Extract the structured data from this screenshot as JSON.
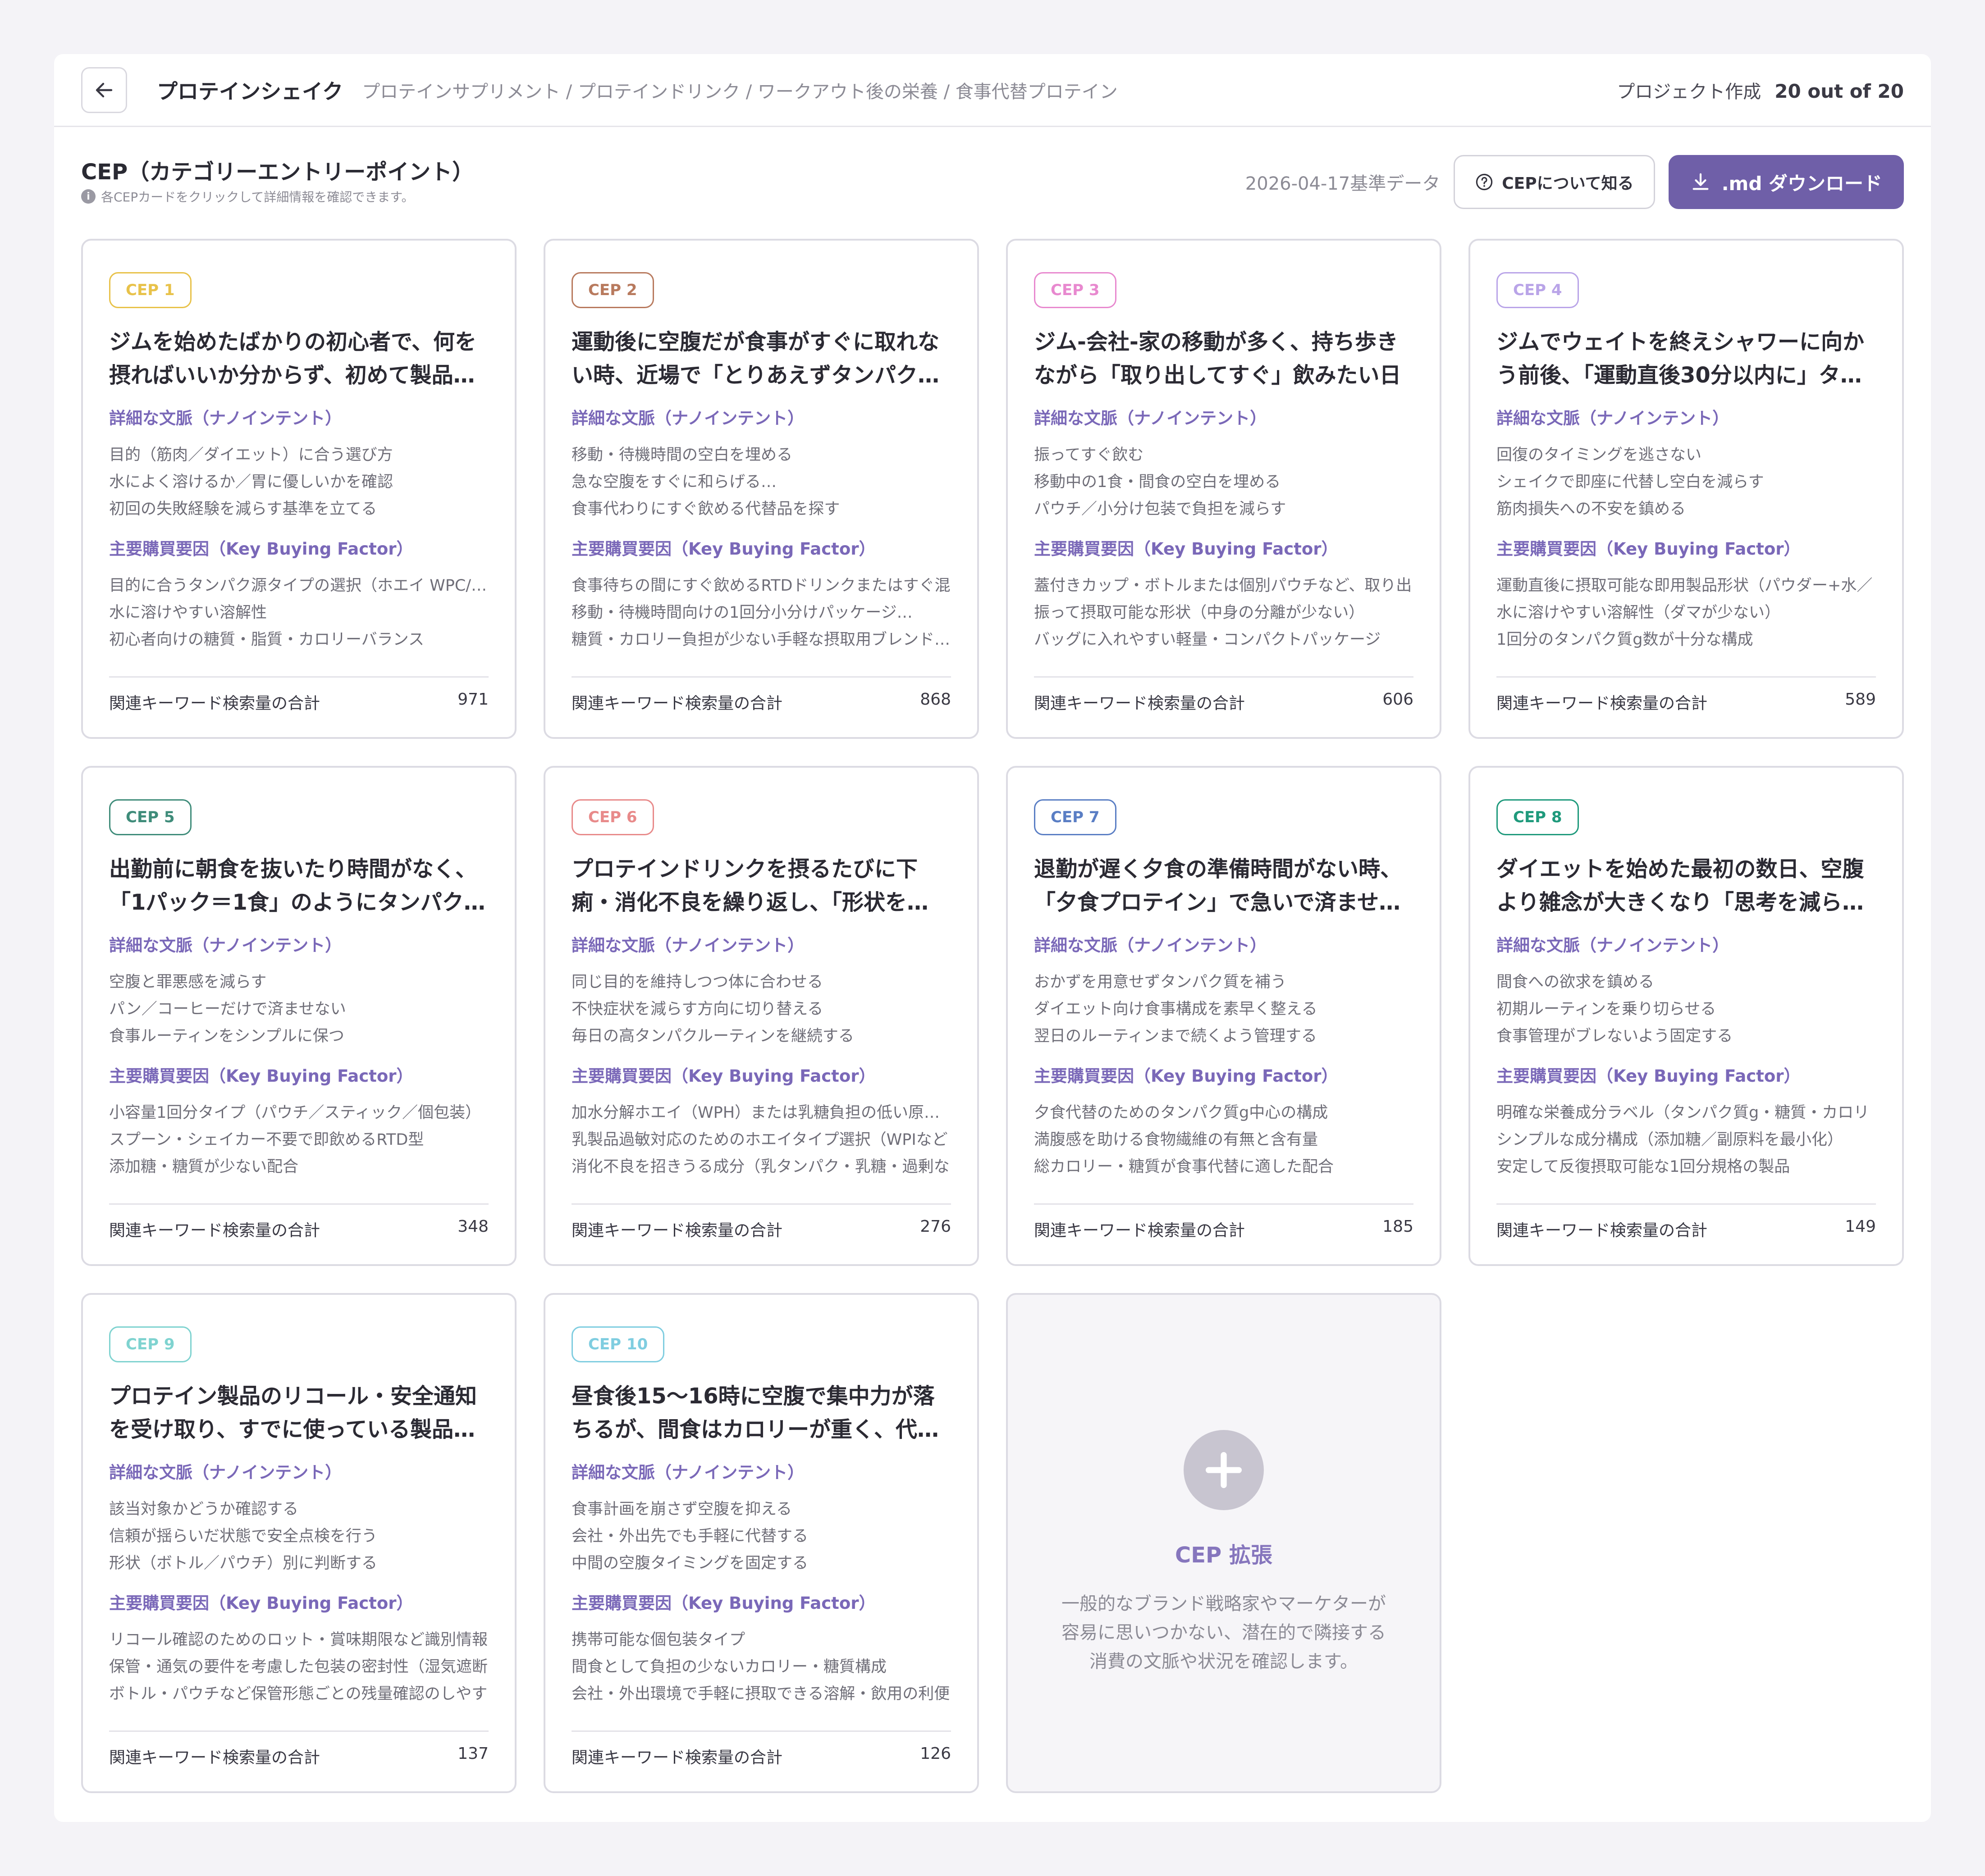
{
  "header": {
    "title": "プロテインシェイク",
    "subtitle": "プロテインサプリメント / プロテインドリンク / ワークアウト後の栄養 / 食事代替プロテイン",
    "project_label": "プロジェクト作成",
    "project_count": "20 out of 20"
  },
  "section": {
    "title": "CEP（カテゴリーエントリーポイント）",
    "hint": "各CEPカードをクリックして詳細情報を確認できます。",
    "date_basis": "2026-04-17基準データ",
    "about_label": "CEPについて知る",
    "download_label": ".md ダウンロード"
  },
  "labels": {
    "context": "詳細な文脈（ナノインテント）",
    "kbf": "主要購買要因（Key Buying Factor）",
    "footer": "関連キーワード検索量の合計"
  },
  "badge_colors": [
    "#e8c24a",
    "#b87a5e",
    "#e889cf",
    "#b9a4e8",
    "#3f8c7a",
    "#e88a8a",
    "#5a7ec4",
    "#1f9a7c",
    "#7fd3d0",
    "#7fcde0"
  ],
  "cards": [
    {
      "badge": "CEP 1",
      "title": "ジムを始めたばかりの初心者で、何を摂ればいいか分からず、初めて製品…",
      "contexts": [
        "目的（筋肉／ダイエット）に合う選び方",
        "水によく溶けるか／胃に優しいかを確認",
        "初回の失敗経験を減らす基準を立てる"
      ],
      "kbfs": [
        "目的に合うタンパク源タイプの選択（ホエイ WPC/WPI",
        "水に溶けやすい溶解性",
        "初心者向けの糖質・脂質・カロリーバランス"
      ],
      "volume": "971"
    },
    {
      "badge": "CEP 2",
      "title": "運動後に空腹だが食事がすぐに取れない時、近場で「とりあえずタンパク…",
      "contexts": [
        "移動・待機時間の空白を埋める",
        "急な空腹をすぐに和らげる…",
        "食事代わりにすぐ飲める代替品を探す"
      ],
      "kbfs": [
        "食事待ちの間にすぐ飲めるRTDドリンクまたはすぐ混",
        "移動・待機時間向けの1回分小分けパッケージ…",
        "糖質・カロリー負担が少ない手軽な摂取用ブレンド…"
      ],
      "volume": "868"
    },
    {
      "badge": "CEP 3",
      "title": "ジム-会社-家の移動が多く、持ち歩きながら「取り出してすぐ」飲みたい日",
      "contexts": [
        "振ってすぐ飲む",
        "移動中の1食・間食の空白を埋める",
        "パウチ／小分け包装で負担を減らす"
      ],
      "kbfs": [
        "蓋付きカップ・ボトルまたは個別パウチなど、取り出",
        "振って摂取可能な形状（中身の分離が少ない）",
        "バッグに入れやすい軽量・コンパクトパッケージ"
      ],
      "volume": "606"
    },
    {
      "badge": "CEP 4",
      "title": "ジムでウェイトを終えシャワーに向かう前後、「運動直後30分以内に」タ…",
      "contexts": [
        "回復のタイミングを逃さない",
        "シェイクで即座に代替し空白を減らす",
        "筋肉損失への不安を鎮める"
      ],
      "kbfs": [
        "運動直後に摂取可能な即用製品形状（パウダー+水／",
        "水に溶けやすい溶解性（ダマが少ない）",
        "1回分のタンパク質g数が十分な構成"
      ],
      "volume": "589"
    },
    {
      "badge": "CEP 5",
      "title": "出勤前に朝食を抜いたり時間がなく、「1パック＝1食」のようにタンパク…",
      "contexts": [
        "空腹と罪悪感を減らす",
        "パン／コーヒーだけで済ませない",
        "食事ルーティンをシンプルに保つ"
      ],
      "kbfs": [
        "小容量1回分タイプ（パウチ／スティック／個包装）",
        "スプーン・シェイカー不要で即飲めるRTD型",
        "添加糖・糖質が少ない配合"
      ],
      "volume": "348"
    },
    {
      "badge": "CEP 6",
      "title": "プロテインドリンクを摂るたびに下痢・消化不良を繰り返し、「形状を…",
      "contexts": [
        "同じ目的を維持しつつ体に合わせる",
        "不快症状を減らす方向に切り替える",
        "毎日の高タンパクルーティンを継続する"
      ],
      "kbfs": [
        "加水分解ホエイ（WPH）または乳糖負担の低い原料タ",
        "乳製品過敏対応のためのホエイタイプ選択（WPIなど",
        "消化不良を招きうる成分（乳タンパク・乳糖・過剰な"
      ],
      "volume": "276"
    },
    {
      "badge": "CEP 7",
      "title": "退勤が遅く夕食の準備時間がない時、「夕食プロテイン」で急いで済ませ…",
      "contexts": [
        "おかずを用意せずタンパク質を補う",
        "ダイエット向け食事構成を素早く整える",
        "翌日のルーティンまで続くよう管理する"
      ],
      "kbfs": [
        "夕食代替のためのタンパク質g中心の構成",
        "満腹感を助ける食物繊維の有無と含有量",
        "総カロリー・糖質が食事代替に適した配合"
      ],
      "volume": "185"
    },
    {
      "badge": "CEP 8",
      "title": "ダイエットを始めた最初の数日、空腹より雑念が大きくなり「思考を減ら…",
      "contexts": [
        "間食への欲求を鎮める",
        "初期ルーティンを乗り切らせる",
        "食事管理がブレないよう固定する"
      ],
      "kbfs": [
        "明確な栄養成分ラベル（タンパク質g・糖質・カロリ",
        "シンプルな成分構成（添加糖／副原料を最小化）",
        "安定して反復摂取可能な1回分規格の製品"
      ],
      "volume": "149"
    },
    {
      "badge": "CEP 9",
      "title": "プロテイン製品のリコール・安全通知を受け取り、すでに使っている製品…",
      "contexts": [
        "該当対象かどうか確認する",
        "信頼が揺らいだ状態で安全点検を行う",
        "形状（ボトル／パウチ）別に判断する"
      ],
      "kbfs": [
        "リコール確認のためのロット・賞味期限など識別情報",
        "保管・通気の要件を考慮した包装の密封性（湿気遮断",
        "ボトル・パウチなど保管形態ごとの残量確認のしやす"
      ],
      "volume": "137"
    },
    {
      "badge": "CEP 10",
      "title": "昼食後15〜16時に空腹で集中力が落ちるが、間食はカロリーが重く、代わ…",
      "contexts": [
        "食事計画を崩さず空腹を抑える",
        "会社・外出先でも手軽に代替する",
        "中間の空腹タイミングを固定する"
      ],
      "kbfs": [
        "携帯可能な個包装タイプ",
        "間食として負担の少ないカロリー・糖質構成",
        "会社・外出環境で手軽に摂取できる溶解・飲用の利便"
      ],
      "volume": "126"
    }
  ],
  "add_card": {
    "title": "CEP 拡張",
    "desc": [
      "一般的なブランド戦略家やマーケターが",
      "容易に思いつかない、潜在的で隣接する",
      "消費の文脈や状況を確認します。"
    ]
  }
}
